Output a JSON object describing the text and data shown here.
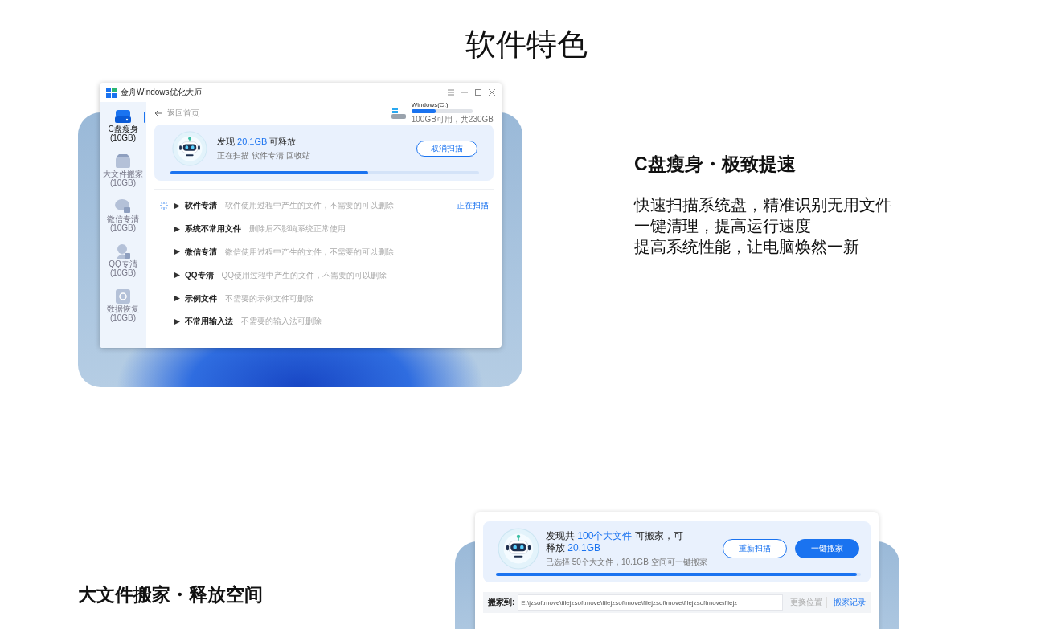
{
  "page_title": "软件特色",
  "feature_1": {
    "heading": "C盘瘦身・极致提速",
    "lines": [
      "快速扫描系统盘，精准识别无用文件",
      "一键清理，提高运行速度",
      "提高系统性能，让电脑焕然一新"
    ],
    "app": {
      "title": "金舟Windows优化大师",
      "nav": [
        {
          "kind": "drive",
          "label": "C盘瘦身",
          "size": "(10GB)",
          "selected": true
        },
        {
          "kind": "box",
          "label": "大文件搬家",
          "size": "(10GB)",
          "selected": false
        },
        {
          "kind": "chat",
          "label": "微信专清",
          "size": "(10GB)",
          "selected": false
        },
        {
          "kind": "person",
          "label": "QQ专清",
          "size": "(10GB)",
          "selected": false
        },
        {
          "kind": "chip",
          "label": "数据恢复",
          "size": "(10GB)",
          "selected": false
        }
      ],
      "back_label": "返回首页",
      "disk": {
        "name": "Windows(C:)",
        "level": 0.4,
        "info": "100GB可用，共230GB"
      },
      "scan": {
        "title_parts": [
          {
            "text": "发现 ",
            "highlight": false
          },
          {
            "text": "20.1GB",
            "highlight": true
          },
          {
            "text": " 可释放",
            "highlight": false
          }
        ],
        "subtitle": "正在扫描 软件专清 回收站",
        "button": "取消扫描",
        "level": 0.64
      },
      "items": [
        {
          "name": "软件专清",
          "desc": "软件使用过程中产生的文件，不需要的可以删除",
          "scanning": true,
          "status": "正在扫描"
        },
        {
          "name": "系统不常用文件",
          "desc": "删除后不影响系统正常使用",
          "scanning": false
        },
        {
          "name": "微信专清",
          "desc": "微信使用过程中产生的文件，不需要的可以删除",
          "scanning": false
        },
        {
          "name": "QQ专清",
          "desc": "QQ使用过程中产生的文件，不需要的可以删除",
          "scanning": false
        },
        {
          "name": "示例文件",
          "desc": "不需要的示例文件可删除",
          "scanning": false
        },
        {
          "name": "不常用输入法",
          "desc": "不需要的输入法可删除",
          "scanning": false
        }
      ]
    }
  },
  "feature_2": {
    "heading": "大文件搬家・释放空间",
    "app": {
      "scan": {
        "title_parts": [
          {
            "text": "发现共 ",
            "highlight": false
          },
          {
            "text": "100个大文件",
            "highlight": true
          },
          {
            "text": " 可搬家，可释放 ",
            "highlight": false
          },
          {
            "text": "20.1GB",
            "highlight": true
          }
        ],
        "subtitle": "已选择 50个大文件，10.1GB 空间可一键搬家",
        "level": 0.99,
        "buttons": [
          {
            "kind": "outline",
            "label": "重新扫描"
          },
          {
            "kind": "primary",
            "label": "一键搬家"
          }
        ]
      },
      "destination": {
        "label": "搬家到:",
        "path": "E:\\jzsoftmove\\filejzsoftmove\\filejzsoftmove\\filejzsoftmove\\filejzsoftmove\\filejz",
        "change": "更换位置",
        "history": "搬家记录"
      }
    }
  }
}
